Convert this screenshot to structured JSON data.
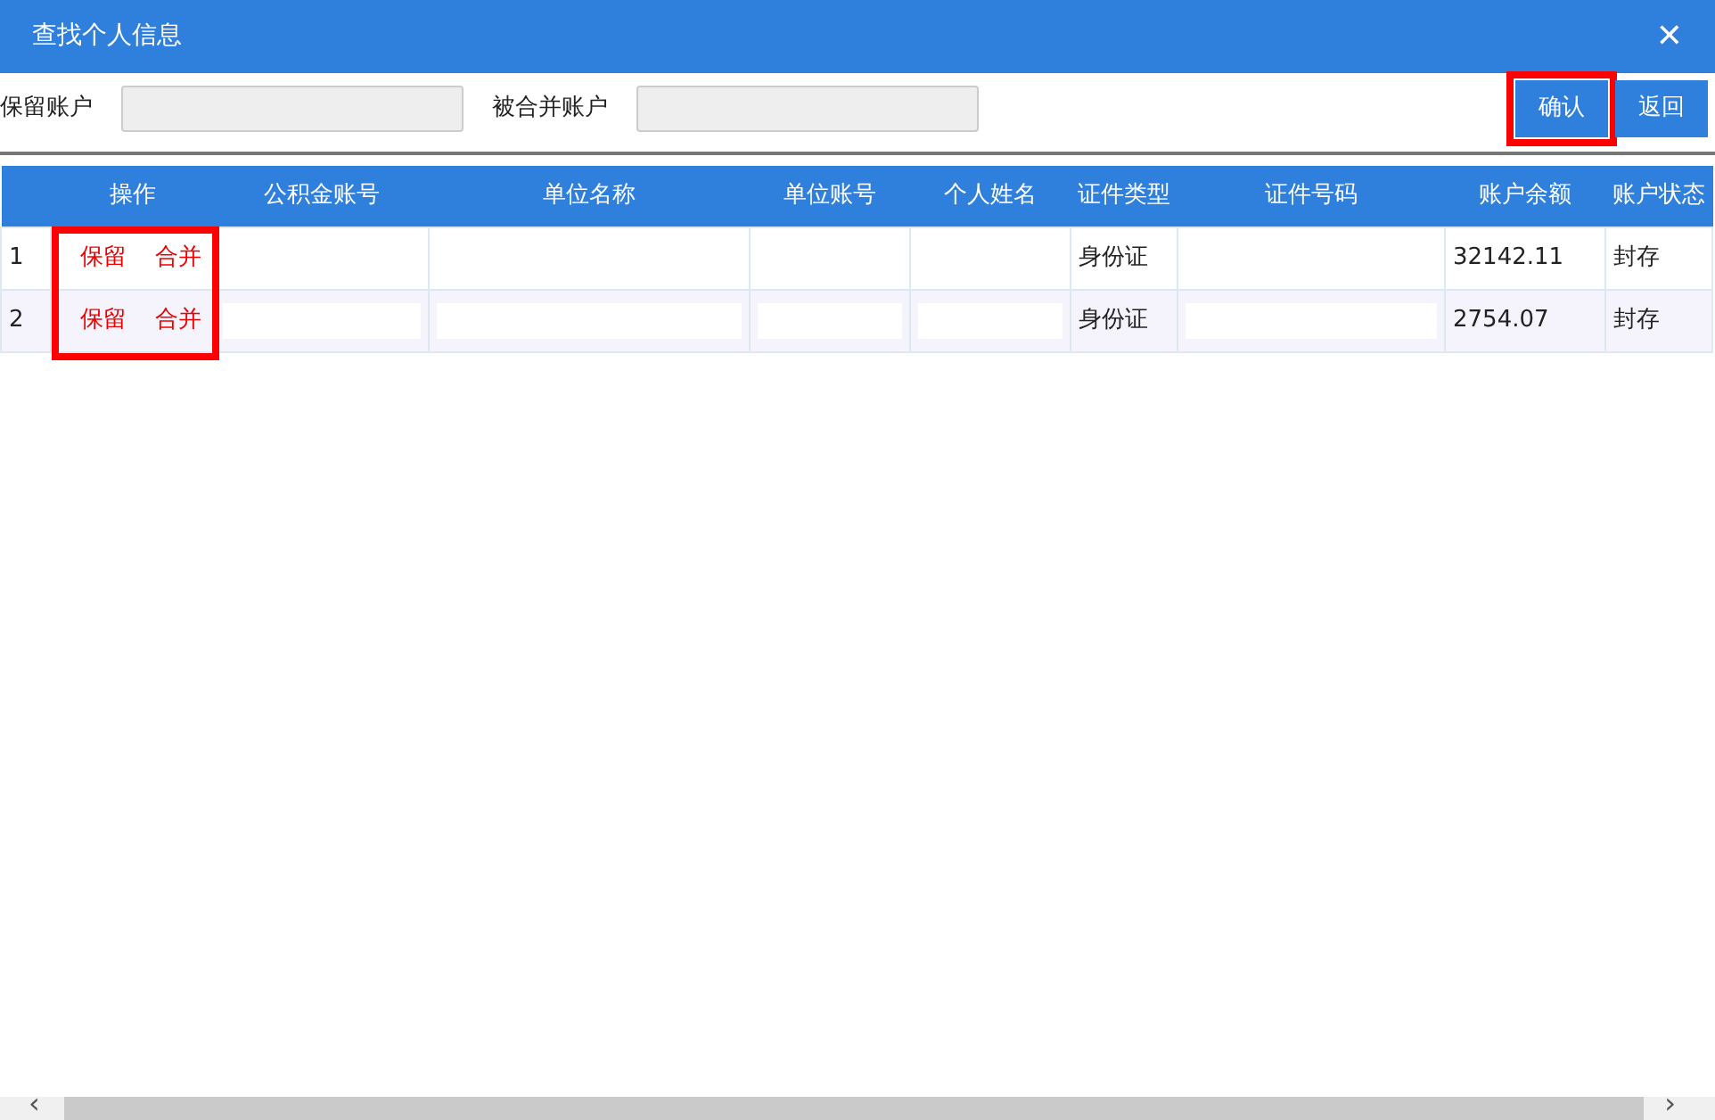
{
  "window": {
    "title": "查找个人信息",
    "close": "✕"
  },
  "filters": [
    {
      "label": "保留账户"
    },
    {
      "label": "被合并账户"
    }
  ],
  "buttons": [
    {
      "label": "确认",
      "highlighted": true
    },
    {
      "label": "返回",
      "highlighted": false
    }
  ],
  "table": {
    "actions_highlighted": true,
    "columns": [
      "操作",
      "公积金账号",
      "单位名称",
      "单位账号",
      "个人姓名",
      "证件类型",
      "证件号码",
      "账户余额",
      "账户状态"
    ],
    "rows": [
      {
        "index": "1",
        "cells": [
          {
            "actions": [
              "保留",
              "合并"
            ]
          },
          "",
          "",
          "",
          "",
          "身份证",
          "",
          "32142.11",
          "封存"
        ]
      },
      {
        "index": "2",
        "cells": [
          {
            "actions": [
              "保留",
              "合并"
            ]
          },
          {
            "redacted": true
          },
          {
            "redacted": true
          },
          {
            "redacted": true
          },
          {
            "redacted": true
          },
          "身份证",
          {
            "redacted": true
          },
          "2754.07",
          "封存"
        ]
      }
    ]
  },
  "scrollbar": {
    "left": "‹",
    "right": "›"
  }
}
